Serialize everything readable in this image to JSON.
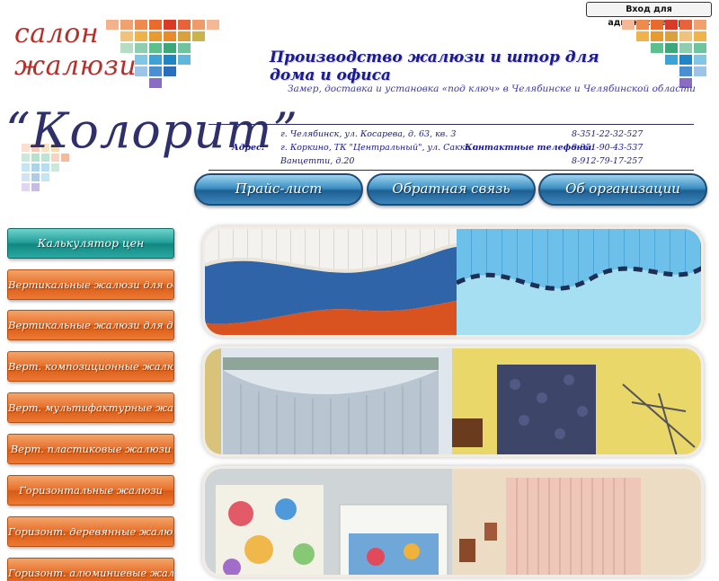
{
  "admin": {
    "login_label": "Вход для администратора"
  },
  "brand": {
    "salon_line1": "салон",
    "salon_line2": "жалюзи",
    "logo": "“Колорит”"
  },
  "header": {
    "heading": "Производство жалюзи и штор для дома и офиса",
    "subheading": "Замер, доставка и установка «под ключ» в Челябинске и Челябинской области"
  },
  "contacts": {
    "address_label": "Адрес:",
    "address_lines": [
      "г. Челябинск, ул. Косарева, д. 63, кв. 3",
      "г. Коркино, ТК \"Центральный\", ул. Сакко и",
      "Ванцетти, д.20"
    ],
    "phones_label": "Контактные телефоны:",
    "phones": [
      "8-351-22-32-527",
      "8-351-90-43-537",
      "8-912-79-17-257"
    ]
  },
  "top_nav": [
    {
      "label": "Прайс-лист"
    },
    {
      "label": "Обратная связь"
    },
    {
      "label": "Об организации"
    }
  ],
  "sidebar": [
    {
      "label": "Калькулятор цен"
    },
    {
      "label": "Вертикальные жалюзи для офиса"
    },
    {
      "label": "Вертикальные жалюзи для дома"
    },
    {
      "label": "Верт. композиционные жалюзи"
    },
    {
      "label": "Верт. мультифактурные жалюзи"
    },
    {
      "label": "Верт. пластиковые жалюзи"
    },
    {
      "label": "Горизонтальные жалюзи"
    },
    {
      "label": "Горизонт. деревянные жалюзи"
    },
    {
      "label": "Горизонт. алюминиевые жалюзи"
    }
  ],
  "colors": {
    "nav_blue": "#2d7ab0",
    "sidebar_orange": "#e8702c",
    "sidebar_teal": "#229d98",
    "heading_blue": "#1a1a8c",
    "brand_red": "#b5302a"
  }
}
